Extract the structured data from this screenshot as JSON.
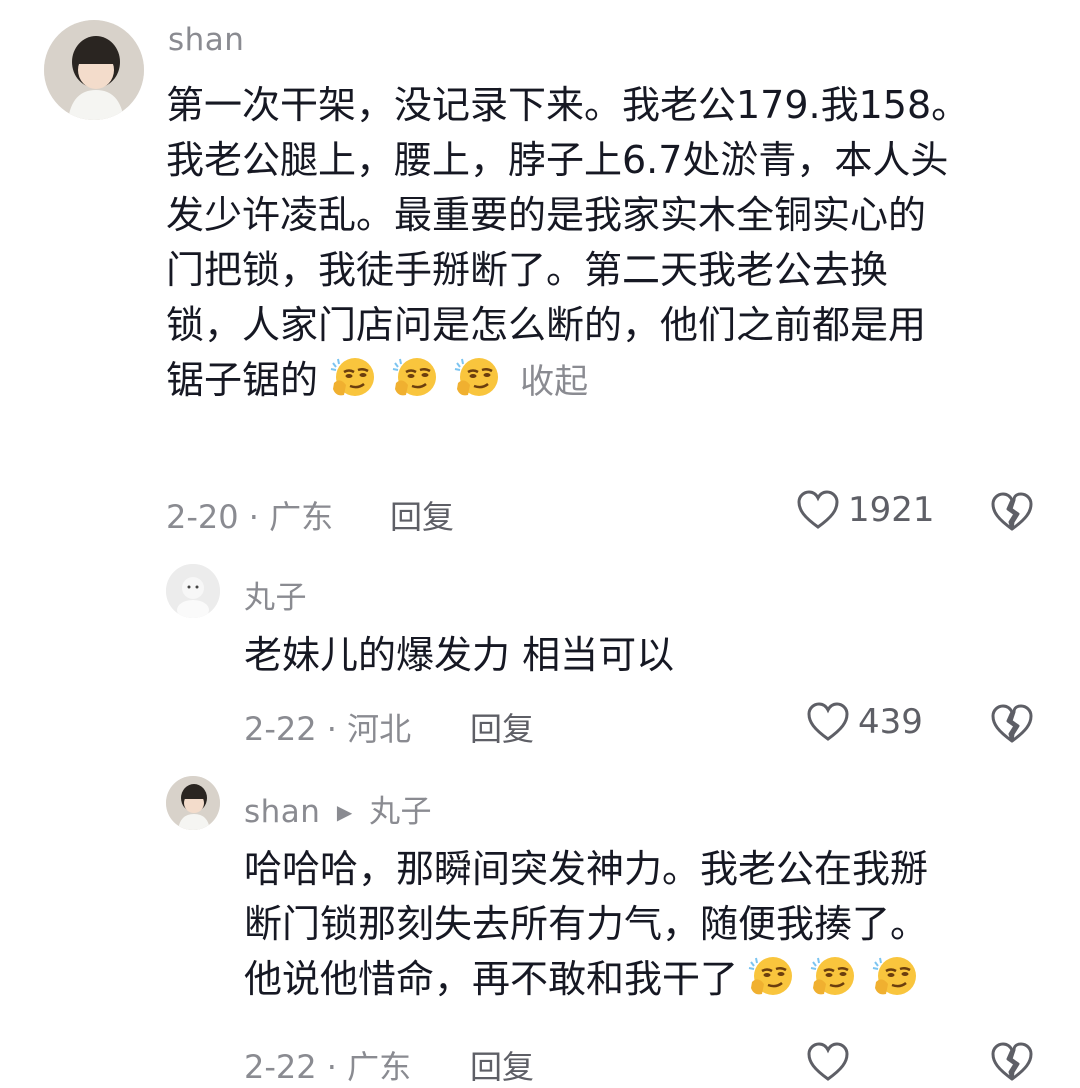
{
  "comments": [
    {
      "username": "shan",
      "lines": [
        "第一次干架，没记录下来。我老公179.我158。",
        "我老公腿上，腰上，脖子上6.7处淤青，本人头",
        "发少许凌乱。最重要的是我家实木全铜实心的",
        "门把锁，我徒手掰断了。第二天我老公去换",
        "锁，人家门店问是怎么断的，他们之前都是用",
        "锯子锯的"
      ],
      "collapse_label": "收起",
      "date_location": "2-20 · 广东",
      "reply_label": "回复",
      "likes": "1921"
    },
    {
      "username": "丸子",
      "text": "老妹儿的爆发力 相当可以",
      "date_location": "2-22 · 河北",
      "reply_label": "回复",
      "likes": "439"
    },
    {
      "username": "shan",
      "reply_to": "丸子",
      "lines": [
        "哈哈哈，那瞬间突发神力。我老公在我掰",
        "断门锁那刻失去所有力气，随便我揍了。",
        "他说他惜命，再不敢和我干了"
      ],
      "date_location": "2-22 · 广东",
      "reply_label": "回复"
    }
  ],
  "icons": {
    "like": "heart-outline-icon",
    "dislike": "broken-heart-icon",
    "emoji": "smirk-thinking-emoji-icon",
    "reply_arrow": "triangle-right-icon"
  },
  "colors": {
    "text": "#161823",
    "muted": "#8a8b91",
    "emoji_yellow": "#f9c53d"
  }
}
